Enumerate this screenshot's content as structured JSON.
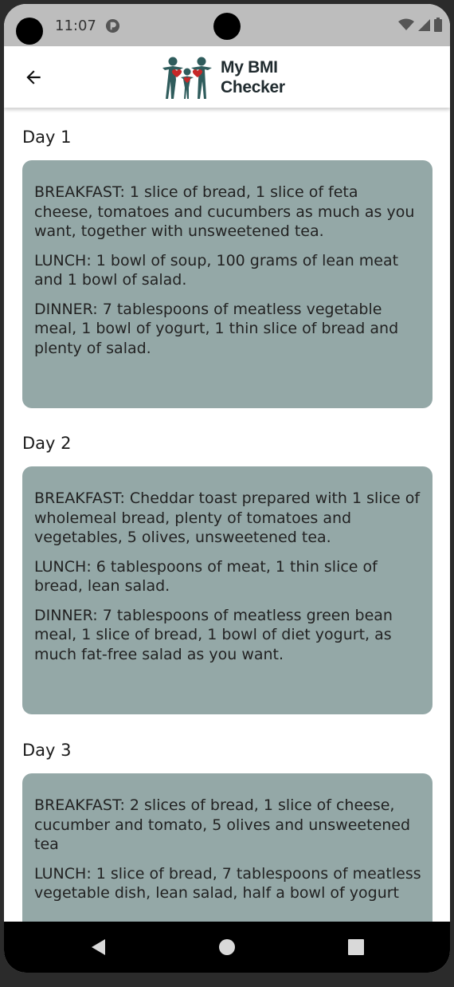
{
  "status_bar": {
    "time": "11:07"
  },
  "app_bar": {
    "brand_line1": "My BMI",
    "brand_line2": "Checker"
  },
  "days": [
    {
      "title": "Day 1",
      "meals": [
        "BREAKFAST:  1 slice of bread, 1 slice of feta cheese, tomatoes and cucumbers as much as you want, together with unsweetened tea.",
        "LUNCH: 1 bowl of soup, 100 grams of lean meat and 1 bowl of salad.",
        "DINNER:  7 tablespoons of meatless vegetable meal, 1 bowl of yogurt, 1 thin slice of bread and plenty of salad."
      ]
    },
    {
      "title": "Day 2",
      "meals": [
        "BREAKFAST: Cheddar toast prepared with 1 slice of wholemeal bread, plenty of tomatoes and vegetables, 5 olives, unsweetened tea.",
        "LUNCH: 6 tablespoons of meat, 1 thin slice of bread, lean salad.",
        "DINNER: 7 tablespoons of meatless green bean meal, 1 slice of bread, 1 bowl of diet yogurt, as much fat-free salad as you want."
      ]
    },
    {
      "title": "Day 3",
      "meals": [
        "BREAKFAST: 2 slices of bread, 1 slice of cheese, cucumber and tomato, 5 olives and unsweetened tea",
        "LUNCH: 1 slice of bread, 7 tablespoons of meatless vegetable dish, lean salad, half a bowl of yogurt"
      ]
    }
  ],
  "colors": {
    "card_bg": "#94a8a7",
    "logo_teal": "#2f5c5c",
    "logo_red": "#c62828"
  }
}
